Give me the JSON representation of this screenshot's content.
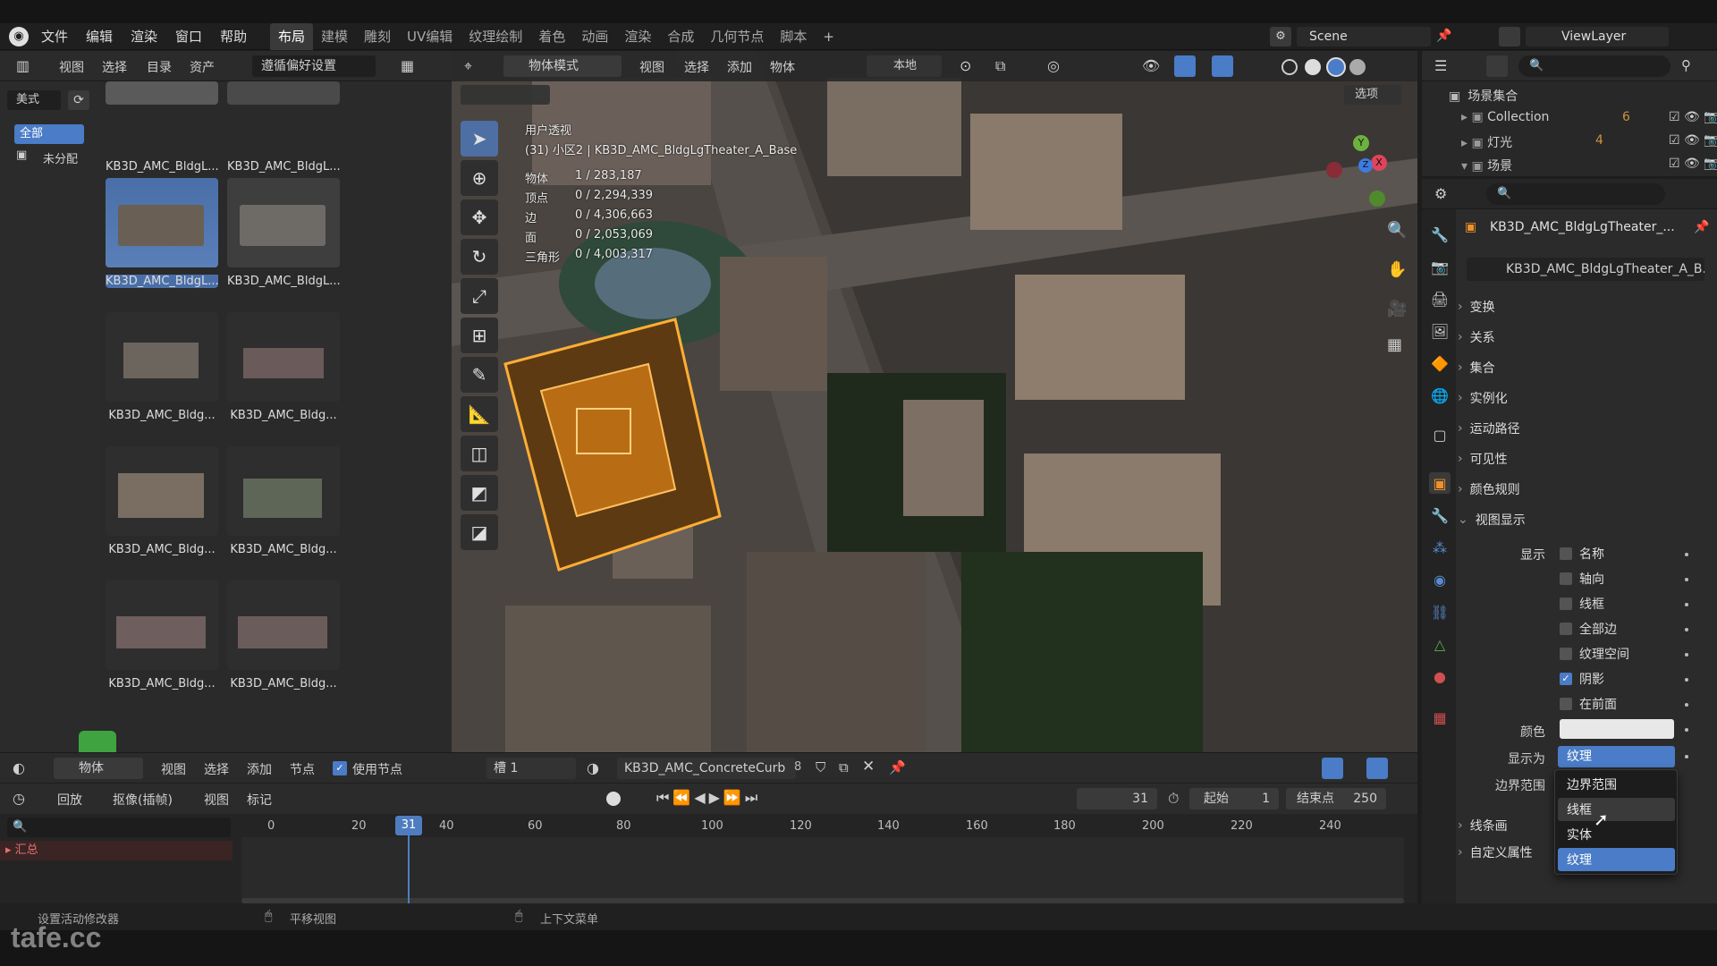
{
  "menubar": {
    "items": [
      "文件",
      "编辑",
      "渲染",
      "窗口",
      "帮助"
    ],
    "workspaces": [
      "布局",
      "建模",
      "雕刻",
      "UV编辑",
      "纹理绘制",
      "着色",
      "动画",
      "渲染",
      "合成",
      "几何节点",
      "脚本"
    ],
    "active_workspace": "布局",
    "add": "+",
    "scene": "Scene",
    "view_layer": "ViewLayer"
  },
  "asset_browser": {
    "menu": [
      "视图",
      "选择",
      "目录",
      "资产"
    ],
    "library": "遵循偏好设置",
    "catalog_label": "美式",
    "catalog_items": [
      "全部",
      "未分配"
    ],
    "assets": [
      "KB3D_AMC_BldgL...",
      "KB3D_AMC_BldgL...",
      "KB3D_AMC_BldgL...",
      "KB3D_AMC_BldgL...",
      "KB3D_AMC_Bldg...",
      "KB3D_AMC_Bldg...",
      "KB3D_AMC_Bldg...",
      "KB3D_AMC_Bldg...",
      "KB3D_AMC_Bldg...",
      "KB3D_AMC_Bldg..."
    ],
    "selected_index": 2
  },
  "viewport": {
    "mode": "物体模式",
    "menu": [
      "视图",
      "选择",
      "添加",
      "物体"
    ],
    "transform": "本地",
    "options": "选项",
    "view_name": "用户透视",
    "object_path": "(31) 小区2 | KB3D_AMC_BldgLgTheater_A_Base",
    "stats": [
      {
        "k": "物体",
        "v": "1 / 283,187"
      },
      {
        "k": "顶点",
        "v": "0 / 2,294,339"
      },
      {
        "k": "边",
        "v": "0 / 4,306,663"
      },
      {
        "k": "面",
        "v": "0 / 2,053,069"
      },
      {
        "k": "三角形",
        "v": "0 / 4,003,317"
      }
    ],
    "gizmo": {
      "x": "X",
      "y": "Y",
      "z": "Z"
    }
  },
  "outliner": {
    "root": "场景集合",
    "items": [
      {
        "name": "Collection",
        "badge": "6"
      },
      {
        "name": "灯光",
        "badge": "4"
      },
      {
        "name": "场景",
        "badge": ""
      }
    ]
  },
  "properties": {
    "object_name": "KB3D_AMC_BldgLgTheater_...",
    "data_name": "KB3D_AMC_BldgLgTheater_A_B...",
    "panels": [
      "变换",
      "关系",
      "集合",
      "实例化",
      "运动路径",
      "可见性",
      "颜色规则"
    ],
    "viewport_display": {
      "title": "视图显示",
      "show_label": "显示",
      "options": [
        {
          "label": "名称",
          "checked": false
        },
        {
          "label": "轴向",
          "checked": false
        },
        {
          "label": "线框",
          "checked": false
        },
        {
          "label": "全部边",
          "checked": false
        },
        {
          "label": "纹理空间",
          "checked": false
        },
        {
          "label": "阴影",
          "checked": true
        },
        {
          "label": "在前面",
          "checked": false
        }
      ],
      "color_label": "颜色",
      "display_as_label": "显示为",
      "display_as_value": "纹理",
      "bounds_label": "边界范围"
    },
    "dropdown_options": [
      "边界范围",
      "线框",
      "实体",
      "纹理"
    ],
    "dropdown_selected": "纹理",
    "dropdown_hover": "线框",
    "panels_after": [
      "线条画",
      "自定义属性"
    ]
  },
  "shader_editor": {
    "type": "物体",
    "menu": [
      "视图",
      "选择",
      "添加",
      "节点"
    ],
    "use_nodes": "使用节点",
    "slot": "槽 1",
    "material": "KB3D_AMC_ConcreteCurb",
    "users": "8"
  },
  "timeline": {
    "menu": [
      "回放",
      "抠像(插帧)",
      "视图",
      "标记"
    ],
    "current_frame": "31",
    "start_label": "起始",
    "start": "1",
    "end_label": "结束点",
    "end": "250",
    "ticks": [
      "0",
      "20",
      "40",
      "60",
      "80",
      "100",
      "120",
      "140",
      "160",
      "180",
      "200",
      "220",
      "240"
    ],
    "summary": "汇总"
  },
  "statusbar": {
    "items": [
      "设置活动修改器",
      "平移视图",
      "上下文菜单"
    ]
  },
  "watermark": "tafe.cc",
  "colors": {
    "accent": "#4a7cc7",
    "selection": "#f39a1f",
    "frame_marker": "#4e7dbf"
  }
}
